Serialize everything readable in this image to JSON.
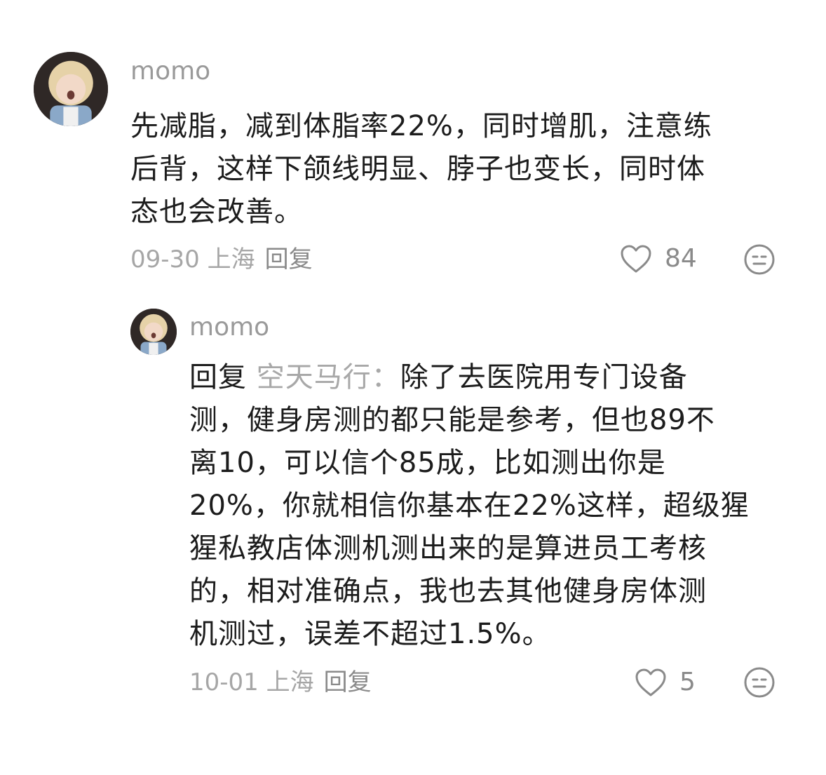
{
  "comments": [
    {
      "username": "momo",
      "text": "先减脂，减到体脂率22%，同时增肌，注意练\n后背，这样下颌线明显、脖子也变长，同时体\n态也会改善。",
      "date_location": "09-30 上海",
      "reply_label": "回复",
      "likes": "84",
      "icons": {
        "like": "heart-icon",
        "react": "smiley-icon"
      }
    },
    {
      "username": "momo",
      "reply_prefix": "回复 ",
      "reply_target": "空天马行：",
      "text": "除了去医院用专门设备\n测，健身房测的都只能是参考，但也89不\n离10，可以信个85成，比如测出你是\n20%，你就相信你基本在22%这样，超级猩\n猩私教店体测机测出来的是算进员工考核\n的，相对准确点，我也去其他健身房体测\n机测过，误差不超过1.5%。",
      "date_location": "10-01 上海",
      "reply_label": "回复",
      "likes": "5",
      "icons": {
        "like": "heart-icon",
        "react": "smiley-icon"
      }
    }
  ],
  "colors": {
    "username": "#9a9a9a",
    "body_text": "#1c1c1c",
    "meta_text": "#a6a6a6",
    "icon_stroke": "#8a8a8a"
  }
}
